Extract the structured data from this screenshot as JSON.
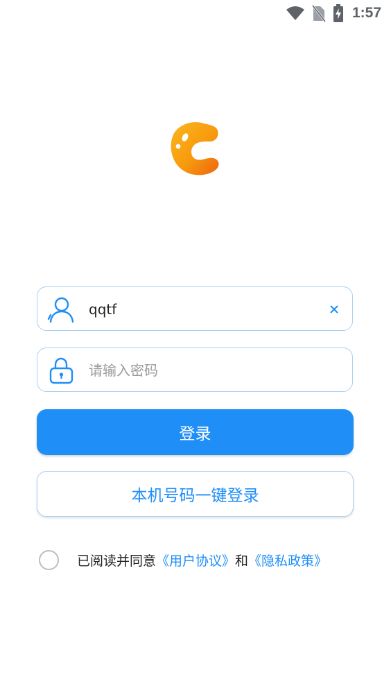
{
  "status_bar": {
    "time": "1:57",
    "icons": [
      "wifi-icon",
      "no-sim-icon",
      "battery-charging-icon"
    ]
  },
  "app": {
    "logo": "app-logo-c"
  },
  "username": {
    "value": "qqtf",
    "icon": "user-icon",
    "clear_icon": "close-icon"
  },
  "password": {
    "placeholder": "请输入密码",
    "icon": "lock-icon"
  },
  "login_button": {
    "label": "登录"
  },
  "onekey_button": {
    "label": "本机号码一键登录"
  },
  "agreement": {
    "prefix": "已阅读并同意",
    "user_agreement": "《用户协议》",
    "and": "和",
    "privacy_policy": "《隐私政策》"
  },
  "colors": {
    "accent": "#1f8ef7",
    "border": "#a9cff3",
    "logo_orange": "#f7a10d"
  }
}
